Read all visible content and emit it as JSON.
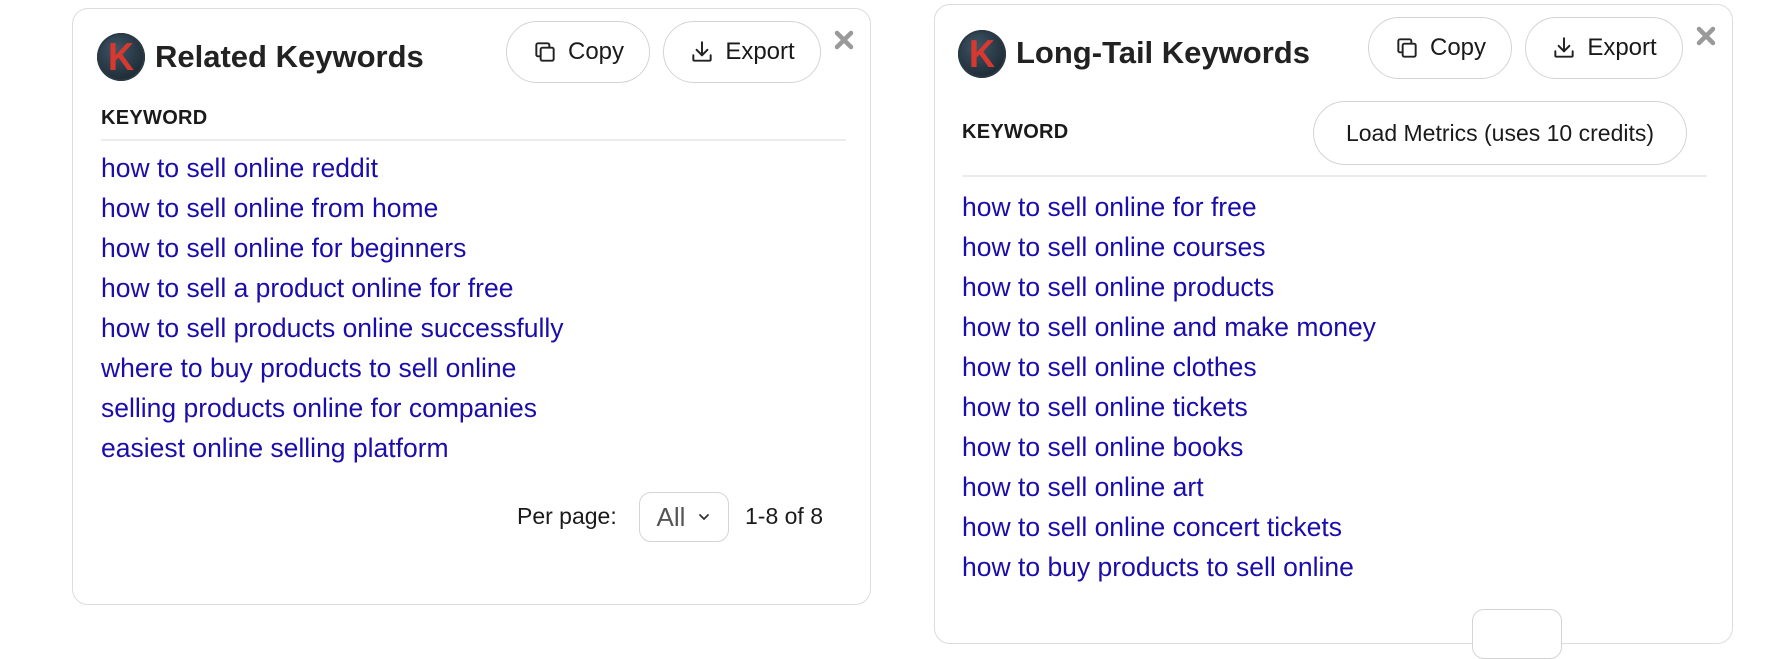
{
  "related": {
    "logo_letter": "K",
    "title": "Related Keywords",
    "copy_label": "Copy",
    "export_label": "Export",
    "column_header": "KEYWORD",
    "keywords": [
      "how to sell online reddit",
      "how to sell online from home",
      "how to sell online for beginners",
      "how to sell a product online for free",
      "how to sell products online successfully",
      "where to buy products to sell online",
      "selling products online for companies",
      "easiest online selling platform"
    ],
    "per_page_label": "Per page:",
    "per_page_value": "All",
    "range_text": "1-8 of 8"
  },
  "longtail": {
    "logo_letter": "K",
    "title": "Long-Tail Keywords",
    "copy_label": "Copy",
    "export_label": "Export",
    "column_header": "KEYWORD",
    "load_metrics_label": "Load Metrics (uses 10 credits)",
    "keywords": [
      "how to sell online for free",
      "how to sell online courses",
      "how to sell online products",
      "how to sell online and make money",
      "how to sell online clothes",
      "how to sell online tickets",
      "how to sell online books",
      "how to sell online art",
      "how to sell online concert tickets",
      "how to buy products to sell online"
    ]
  },
  "colors": {
    "link": "#1a0dab",
    "logo_letter": "#d8392f",
    "border": "#dcdcdc"
  },
  "icons": [
    "copy-icon",
    "export-icon",
    "close-icon",
    "chevron-down-icon"
  ]
}
